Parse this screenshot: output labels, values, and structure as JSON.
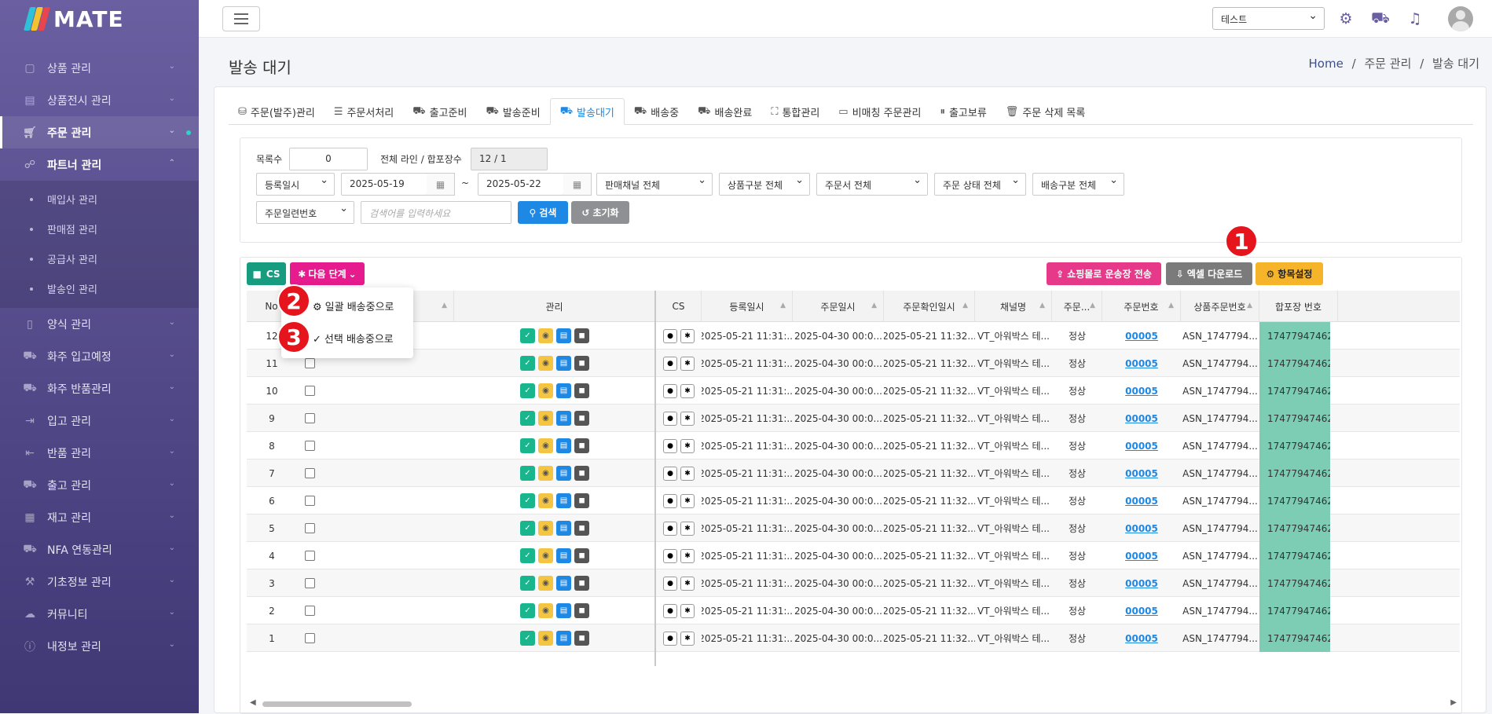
{
  "app": {
    "logo": "MATE"
  },
  "sidebar": {
    "items": [
      {
        "label": "상품 관리",
        "icon": "box-icon"
      },
      {
        "label": "상품전시 관리",
        "icon": "store-icon"
      },
      {
        "label": "주문 관리",
        "icon": "cart-icon"
      },
      {
        "label": "파트너 관리",
        "icon": "handshake-icon"
      }
    ],
    "sub_items": [
      {
        "label": "매입사 관리"
      },
      {
        "label": "판매점 관리"
      },
      {
        "label": "공급사 관리"
      },
      {
        "label": "발송인 관리"
      }
    ],
    "items2": [
      {
        "label": "양식 관리",
        "icon": "file-icon"
      },
      {
        "label": "화주 입고예정",
        "icon": "truck-icon"
      },
      {
        "label": "화주 반품관리",
        "icon": "truck-icon"
      },
      {
        "label": "입고 관리",
        "icon": "login-icon"
      },
      {
        "label": "반품 관리",
        "icon": "logout-icon"
      },
      {
        "label": "출고 관리",
        "icon": "truck-icon"
      },
      {
        "label": "재고 관리",
        "icon": "boxes-icon"
      },
      {
        "label": "NFA 연동관리",
        "icon": "truck-icon"
      },
      {
        "label": "기초정보 관리",
        "icon": "wrench-icon"
      },
      {
        "label": "커뮤니티",
        "icon": "chat-icon"
      },
      {
        "label": "내정보 관리",
        "icon": "info-icon"
      }
    ]
  },
  "topbar": {
    "tenant": "테스트"
  },
  "page": {
    "title": "발송 대기",
    "breadcrumb": {
      "home": "Home",
      "sep": "/",
      "level1": "주문 관리",
      "level2": "발송 대기"
    }
  },
  "tabs": [
    {
      "label": "주문(발주)관리",
      "icon": "bag-icon"
    },
    {
      "label": "주문서처리",
      "icon": "list-check-icon"
    },
    {
      "label": "출고준비",
      "icon": "dolly-icon"
    },
    {
      "label": "발송준비",
      "icon": "truck-loading-icon"
    },
    {
      "label": "발송대기",
      "icon": "truck-icon"
    },
    {
      "label": "배송중",
      "icon": "truck-fast-icon"
    },
    {
      "label": "배송완료",
      "icon": "truck-ramp-icon"
    },
    {
      "label": "통합관리",
      "icon": "cubes-icon"
    },
    {
      "label": "비매칭 주문관리",
      "icon": "calendar-icon"
    },
    {
      "label": "출고보류",
      "icon": "pause-icon"
    },
    {
      "label": "주문 삭제 목록",
      "icon": "trash-icon"
    }
  ],
  "filter": {
    "count_label": "목록수",
    "count_value": "0",
    "total_label": "전체 라인 / 합포장수",
    "total_value": "12 / 1",
    "date_type": "등록일시",
    "date_from": "2025-05-19",
    "date_tilde": "~",
    "date_to": "2025-05-22",
    "channel": "판매채널 전체",
    "product_type": "상품구분 전체",
    "order_form": "주문서 전체",
    "order_status": "주문 상태 전체",
    "delivery_type": "배송구분 전체",
    "search_field": "주문일련번호",
    "search_placeholder": "검색어를 입력하세요",
    "search_btn": "검색",
    "reset_btn": "초기화"
  },
  "toolbar": {
    "cs": "CS",
    "next_step": "다음 단계",
    "send_invoice": "쇼핑몰로 운송장 전송",
    "excel": "엑셀 다운로드",
    "columns": "항목설정"
  },
  "dropdown": {
    "bulk": "일괄 배송중으로",
    "selected": "선택 배송중으로"
  },
  "badges": [
    "1",
    "2",
    "3"
  ],
  "table": {
    "headers": {
      "no": "No",
      "manage": "관리",
      "cs": "CS",
      "reg": "등록일시",
      "order_date": "주문일시",
      "confirm": "주문확인일시",
      "channel": "채널명",
      "status": "주문...",
      "order_no": "주문번호",
      "product_no": "상품주문번호",
      "invoice": "합포장 번호"
    },
    "rows": [
      {
        "no": "12",
        "reg": "2025-05-21 11:31:...",
        "order_date": "2025-04-30 00:0...",
        "confirm": "2025-05-21 11:32...",
        "channel": "VT_아워박스 테...",
        "status": "정상",
        "order_no": "00005",
        "product_no": "ASN_1747794...",
        "invoice": "17477947462"
      },
      {
        "no": "11",
        "reg": "2025-05-21 11:31:...",
        "order_date": "2025-04-30 00:0...",
        "confirm": "2025-05-21 11:32...",
        "channel": "VT_아워박스 테...",
        "status": "정상",
        "order_no": "00005",
        "product_no": "ASN_1747794...",
        "invoice": "17477947462"
      },
      {
        "no": "10",
        "reg": "2025-05-21 11:31:...",
        "order_date": "2025-04-30 00:0...",
        "confirm": "2025-05-21 11:32...",
        "channel": "VT_아워박스 테...",
        "status": "정상",
        "order_no": "00005",
        "product_no": "ASN_1747794...",
        "invoice": "17477947462"
      },
      {
        "no": "9",
        "reg": "2025-05-21 11:31:...",
        "order_date": "2025-04-30 00:0...",
        "confirm": "2025-05-21 11:32...",
        "channel": "VT_아워박스 테...",
        "status": "정상",
        "order_no": "00005",
        "product_no": "ASN_1747794...",
        "invoice": "17477947462"
      },
      {
        "no": "8",
        "reg": "2025-05-21 11:31:...",
        "order_date": "2025-04-30 00:0...",
        "confirm": "2025-05-21 11:32...",
        "channel": "VT_아워박스 테...",
        "status": "정상",
        "order_no": "00005",
        "product_no": "ASN_1747794...",
        "invoice": "17477947462"
      },
      {
        "no": "7",
        "reg": "2025-05-21 11:31:...",
        "order_date": "2025-04-30 00:0...",
        "confirm": "2025-05-21 11:32...",
        "channel": "VT_아워박스 테...",
        "status": "정상",
        "order_no": "00005",
        "product_no": "ASN_1747794...",
        "invoice": "17477947462"
      },
      {
        "no": "6",
        "reg": "2025-05-21 11:31:...",
        "order_date": "2025-04-30 00:0...",
        "confirm": "2025-05-21 11:32...",
        "channel": "VT_아워박스 테...",
        "status": "정상",
        "order_no": "00005",
        "product_no": "ASN_1747794...",
        "invoice": "17477947462"
      },
      {
        "no": "5",
        "reg": "2025-05-21 11:31:...",
        "order_date": "2025-04-30 00:0...",
        "confirm": "2025-05-21 11:32...",
        "channel": "VT_아워박스 테...",
        "status": "정상",
        "order_no": "00005",
        "product_no": "ASN_1747794...",
        "invoice": "17477947462"
      },
      {
        "no": "4",
        "reg": "2025-05-21 11:31:...",
        "order_date": "2025-04-30 00:0...",
        "confirm": "2025-05-21 11:32...",
        "channel": "VT_아워박스 테...",
        "status": "정상",
        "order_no": "00005",
        "product_no": "ASN_1747794...",
        "invoice": "17477947462"
      },
      {
        "no": "3",
        "reg": "2025-05-21 11:31:...",
        "order_date": "2025-04-30 00:0...",
        "confirm": "2025-05-21 11:32...",
        "channel": "VT_아워박스 테...",
        "status": "정상",
        "order_no": "00005",
        "product_no": "ASN_1747794...",
        "invoice": "17477947462"
      },
      {
        "no": "2",
        "reg": "2025-05-21 11:31:...",
        "order_date": "2025-04-30 00:0...",
        "confirm": "2025-05-21 11:32...",
        "channel": "VT_아워박스 테...",
        "status": "정상",
        "order_no": "00005",
        "product_no": "ASN_1747794...",
        "invoice": "17477947462"
      },
      {
        "no": "1",
        "reg": "2025-05-21 11:31:...",
        "order_date": "2025-04-30 00:0...",
        "confirm": "2025-05-21 11:32...",
        "channel": "VT_아워박스 테...",
        "status": "정상",
        "order_no": "00005",
        "product_no": "ASN_1747794...",
        "invoice": "17477947462"
      }
    ]
  },
  "colors": {
    "accent": "#1e88e5",
    "sidebar": "#5a4f94",
    "cs_btn": "#179c7f",
    "next_btn": "#e61b8d",
    "send_btn": "#e6398a",
    "excel_btn": "#7b7b7b",
    "columns_btn": "#f5b42a",
    "search_btn": "#1e88e5",
    "reset_btn": "#8e9094",
    "badge": "#e5141d"
  }
}
